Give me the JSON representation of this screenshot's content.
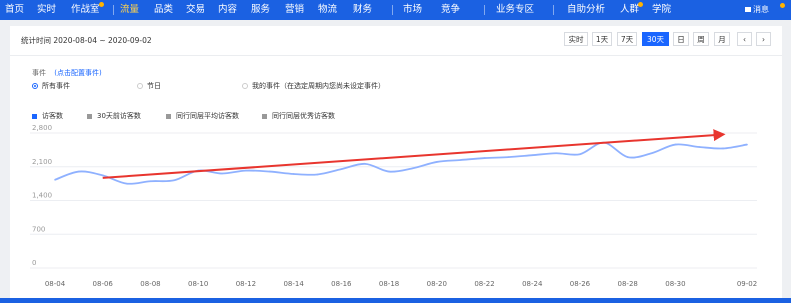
{
  "nav": {
    "items": [
      {
        "label": "首页",
        "active": false,
        "dot": false
      },
      {
        "label": "实时",
        "active": false,
        "dot": false
      },
      {
        "label": "作战室",
        "active": false,
        "dot": true
      },
      {
        "label": "流量",
        "active": true,
        "dot": false
      },
      {
        "label": "品类",
        "active": false,
        "dot": false
      },
      {
        "label": "交易",
        "active": false,
        "dot": false
      },
      {
        "label": "内容",
        "active": false,
        "dot": false
      },
      {
        "label": "服务",
        "active": false,
        "dot": false
      },
      {
        "label": "营销",
        "active": false,
        "dot": false
      },
      {
        "label": "物流",
        "active": false,
        "dot": false
      },
      {
        "label": "财务",
        "active": false,
        "dot": false
      },
      {
        "label": "市场",
        "active": false,
        "dot": false
      },
      {
        "label": "竞争",
        "active": false,
        "dot": false
      },
      {
        "label": "业务专区",
        "active": false,
        "dot": false
      },
      {
        "label": "自助分析",
        "active": false,
        "dot": false
      },
      {
        "label": "人群",
        "active": false,
        "dot": true
      },
      {
        "label": "学院",
        "active": false,
        "dot": false
      }
    ],
    "message": "消息",
    "colors": {
      "bar": "#1b61e2",
      "active": "#ffd34d",
      "dot": "#ffb300"
    }
  },
  "toolbar": {
    "date_range": "统计时间 2020-08-04 ~ 2020-09-02",
    "tabs": [
      {
        "label": "实时",
        "active": false
      },
      {
        "label": "1天",
        "active": false
      },
      {
        "label": "7天",
        "active": false
      },
      {
        "label": "30天",
        "active": true
      },
      {
        "label": "日",
        "active": false
      },
      {
        "label": "周",
        "active": false
      },
      {
        "label": "月",
        "active": false
      },
      {
        "label": "‹",
        "active": false
      },
      {
        "label": "›",
        "active": false
      }
    ]
  },
  "events": {
    "title": "事件",
    "config_link": "(点击配置事件)",
    "options": [
      {
        "label": "所有事件",
        "selected": true,
        "muted": false
      },
      {
        "label": "节日",
        "selected": false,
        "muted": false
      },
      {
        "label": "我的事件（在选定周期内您尚未设定事件）",
        "selected": false,
        "muted": false
      }
    ]
  },
  "legend": [
    {
      "label": "访客数",
      "color": "#1a66ff"
    },
    {
      "label": "30天前访客数",
      "color": "#999999"
    },
    {
      "label": "同行同层平均访客数",
      "color": "#999999"
    },
    {
      "label": "同行同层优秀访客数",
      "color": "#999999"
    }
  ],
  "chart_data": {
    "type": "line",
    "title": "",
    "xlabel": "",
    "ylabel": "",
    "ylim": [
      0,
      2800
    ],
    "yticks": [
      0,
      700,
      1400,
      2100,
      2800
    ],
    "ytick_labels": [
      "0",
      "700",
      "1,400",
      "2,100",
      "2,800"
    ],
    "xtick_labels": [
      "08-04",
      "08-06",
      "08-08",
      "08-10",
      "08-12",
      "08-14",
      "08-16",
      "08-18",
      "08-20",
      "08-22",
      "08-24",
      "08-26",
      "08-28",
      "08-30",
      "09-02"
    ],
    "grid": true,
    "series": [
      {
        "name": "访客数",
        "color": "#8fb1ff",
        "x": [
          "08-04",
          "08-05",
          "08-06",
          "08-07",
          "08-08",
          "08-09",
          "08-10",
          "08-11",
          "08-12",
          "08-13",
          "08-14",
          "08-15",
          "08-16",
          "08-17",
          "08-18",
          "08-19",
          "08-20",
          "08-21",
          "08-22",
          "08-23",
          "08-24",
          "08-25",
          "08-26",
          "08-27",
          "08-28",
          "08-29",
          "08-30",
          "08-31",
          "09-01",
          "09-02"
        ],
        "values": [
          1830,
          2000,
          1920,
          1750,
          1800,
          1820,
          2020,
          1960,
          2020,
          2000,
          1950,
          1940,
          2050,
          2160,
          2000,
          2070,
          2200,
          2240,
          2280,
          2300,
          2340,
          2380,
          2360,
          2600,
          2300,
          2380,
          2560,
          2510,
          2480,
          2560
        ]
      }
    ],
    "annotations": [
      {
        "type": "arrow",
        "color": "#e8352e",
        "from": {
          "x": "08-06",
          "y": 1870
        },
        "to": {
          "x": "09-01",
          "y": 2770
        }
      }
    ]
  }
}
